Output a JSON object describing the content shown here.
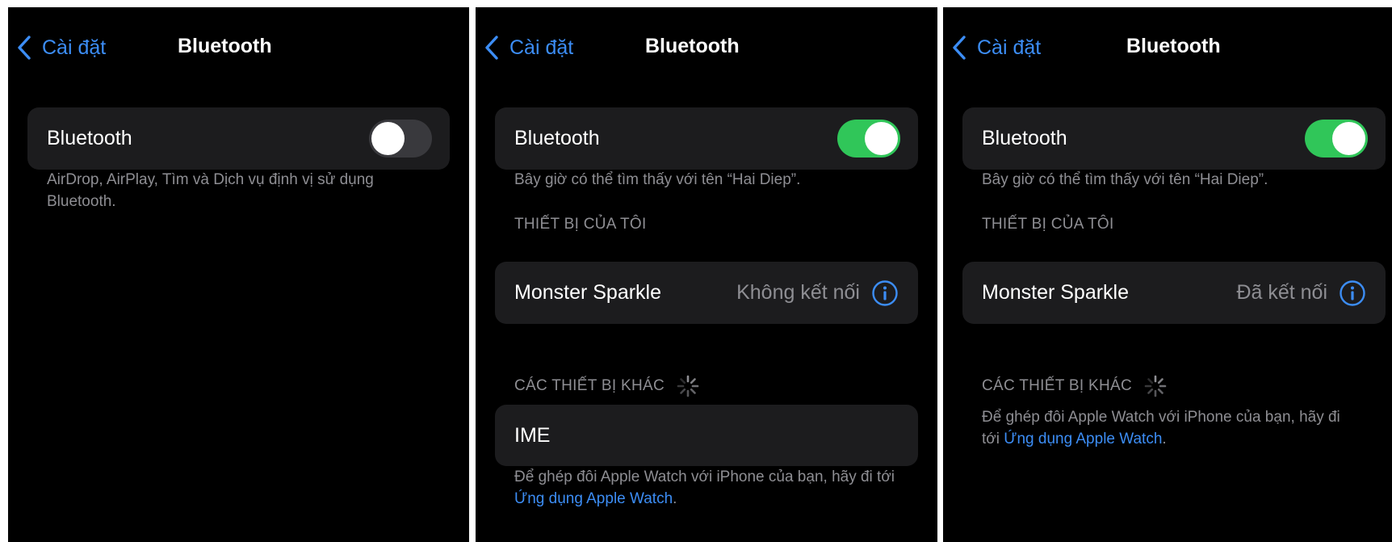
{
  "screens": [
    {
      "nav": {
        "back_label": "Cài đặt",
        "title": "Bluetooth"
      },
      "bluetooth_row": {
        "label": "Bluetooth",
        "enabled": false
      },
      "footnote": "AirDrop, AirPlay, Tìm và Dịch vụ định vị sử dụng Bluetooth."
    },
    {
      "nav": {
        "back_label": "Cài đặt",
        "title": "Bluetooth"
      },
      "bluetooth_row": {
        "label": "Bluetooth",
        "enabled": true
      },
      "discoverable_note": "Bây giờ có thể tìm thấy với tên “Hai Diep”.",
      "my_devices_header": "THIẾT BỊ CỦA TÔI",
      "my_devices": [
        {
          "name": "Monster Sparkle",
          "status": "Không kết nối"
        }
      ],
      "other_devices_header": "CÁC THIẾT BỊ KHÁC",
      "other_devices": [
        {
          "name": "IME"
        }
      ],
      "watch_note_prefix": "Để ghép đôi Apple Watch với iPhone của bạn, hãy đi tới ",
      "watch_note_link": "Ứng dụng Apple Watch",
      "watch_note_suffix": "."
    },
    {
      "nav": {
        "back_label": "Cài đặt",
        "title": "Bluetooth"
      },
      "bluetooth_row": {
        "label": "Bluetooth",
        "enabled": true
      },
      "discoverable_note": "Bây giờ có thể tìm thấy với tên “Hai Diep”.",
      "my_devices_header": "THIẾT BỊ CỦA TÔI",
      "my_devices": [
        {
          "name": "Monster Sparkle",
          "status": "Đã kết nối"
        }
      ],
      "other_devices_header": "CÁC THIẾT BỊ KHÁC",
      "watch_note_prefix": "Để ghép đôi Apple Watch với iPhone của bạn, hãy đi tới ",
      "watch_note_link": "Ứng dụng Apple Watch",
      "watch_note_suffix": "."
    }
  ],
  "colors": {
    "accent": "#3c8df5",
    "toggle_on": "#30c659",
    "toggle_off": "#39393d",
    "card_bg": "#1c1c1e",
    "secondary_text": "#8e8e93"
  },
  "icons": {
    "back": "chevron-left-icon",
    "info": "info-circle-icon",
    "loading": "spinner-icon"
  }
}
